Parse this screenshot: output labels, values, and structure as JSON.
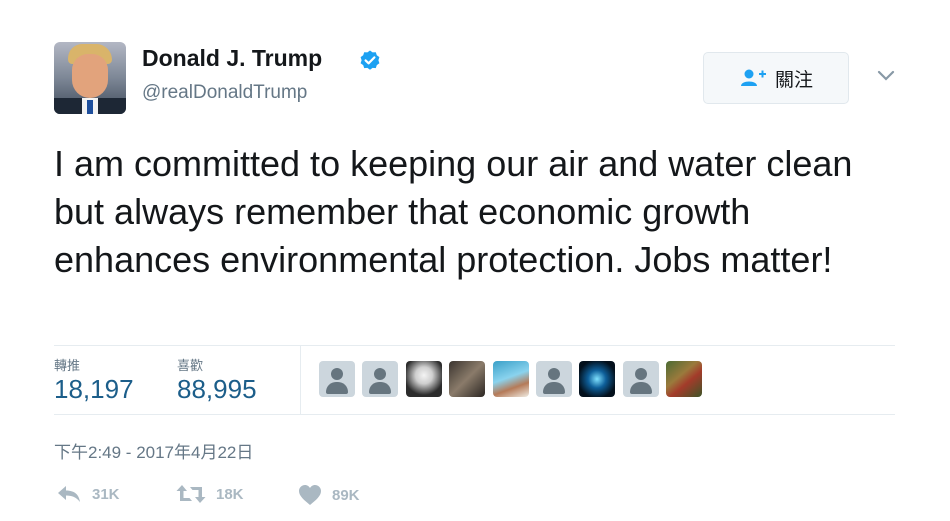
{
  "author": {
    "name": "Donald J. Trump",
    "handle": "@realDonaldTrump",
    "verified_color": "#1da1f2"
  },
  "follow_button": {
    "label": "關注",
    "icon": "add-user-icon"
  },
  "tweet": {
    "text": "I am committed to keeping our air and water clean but always remember that economic growth enhances environmental protection. Jobs matter!"
  },
  "stats": {
    "retweets": {
      "label": "轉推",
      "value": "18,197"
    },
    "likes": {
      "label": "喜歡",
      "value": "88,995"
    }
  },
  "likers": [
    "default-avatar-icon",
    "default-avatar-icon",
    "photo-avatar",
    "photo-avatar",
    "photo-avatar",
    "default-avatar-icon",
    "photo-avatar",
    "default-avatar-icon",
    "photo-avatar"
  ],
  "timestamp": "下午2:49 - 2017年4月22日",
  "actions": {
    "reply": {
      "count": "31K",
      "icon": "reply-icon"
    },
    "retweet": {
      "count": "18K",
      "icon": "retweet-icon"
    },
    "like": {
      "count": "89K",
      "icon": "heart-icon"
    }
  },
  "colors": {
    "accent": "#1da1f2",
    "stat_value": "#1c5e8a",
    "muted": "#657786",
    "action": "#aab8c2"
  }
}
